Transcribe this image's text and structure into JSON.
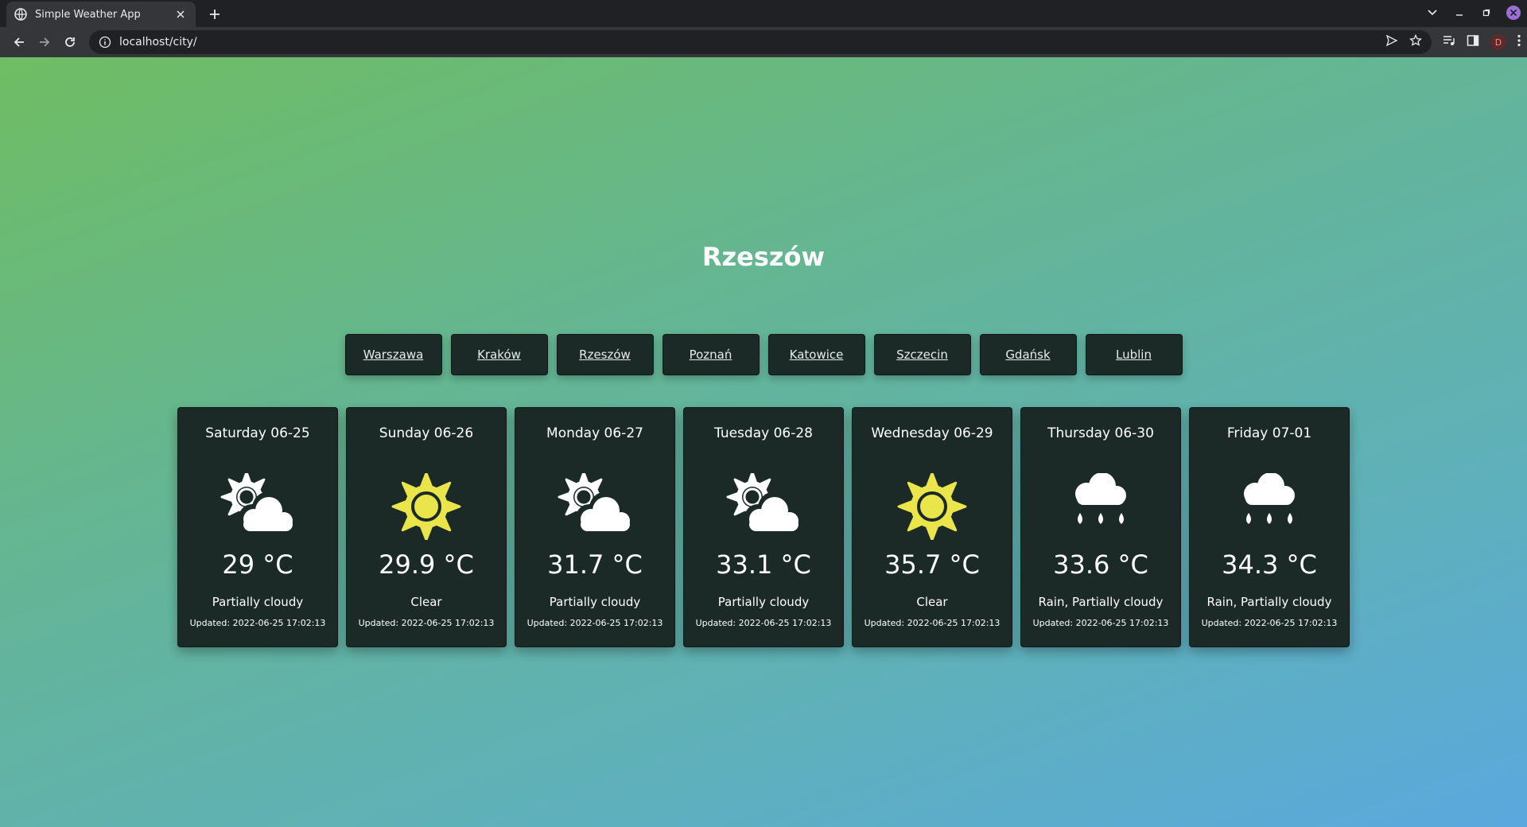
{
  "browser": {
    "tab_title": "Simple Weather App",
    "url": "localhost/city/",
    "profile_initial": "D"
  },
  "page": {
    "city": "Rzeszów",
    "cities": [
      "Warszawa",
      "Kraków",
      "Rzeszów",
      "Poznań",
      "Katowice",
      "Szczecin",
      "Gdańsk",
      "Lublin"
    ],
    "updated_prefix": "Updated:",
    "forecast": [
      {
        "day": "Saturday 06-25",
        "temp": "29 °C",
        "condition": "Partially cloudy",
        "icon": "partly-cloudy-icon",
        "updated": "2022-06-25 17:02:13"
      },
      {
        "day": "Sunday 06-26",
        "temp": "29.9 °C",
        "condition": "Clear",
        "icon": "sun-icon",
        "updated": "2022-06-25 17:02:13"
      },
      {
        "day": "Monday 06-27",
        "temp": "31.7 °C",
        "condition": "Partially cloudy",
        "icon": "partly-cloudy-icon",
        "updated": "2022-06-25 17:02:13"
      },
      {
        "day": "Tuesday 06-28",
        "temp": "33.1 °C",
        "condition": "Partially cloudy",
        "icon": "partly-cloudy-icon",
        "updated": "2022-06-25 17:02:13"
      },
      {
        "day": "Wednesday 06-29",
        "temp": "35.7 °C",
        "condition": "Clear",
        "icon": "sun-icon",
        "updated": "2022-06-25 17:02:13"
      },
      {
        "day": "Thursday 06-30",
        "temp": "33.6 °C",
        "condition": "Rain, Partially cloudy",
        "icon": "rain-cloud-icon",
        "updated": "2022-06-25 17:02:13"
      },
      {
        "day": "Friday 07-01",
        "temp": "34.3 °C",
        "condition": "Rain, Partially cloudy",
        "icon": "rain-cloud-icon",
        "updated": "2022-06-25 17:02:13"
      }
    ]
  },
  "colors": {
    "card_bg": "#1b2a27",
    "sun_yellow": "#e9e54a",
    "gradient_start": "#6fbd63",
    "gradient_end": "#5aa8de"
  }
}
